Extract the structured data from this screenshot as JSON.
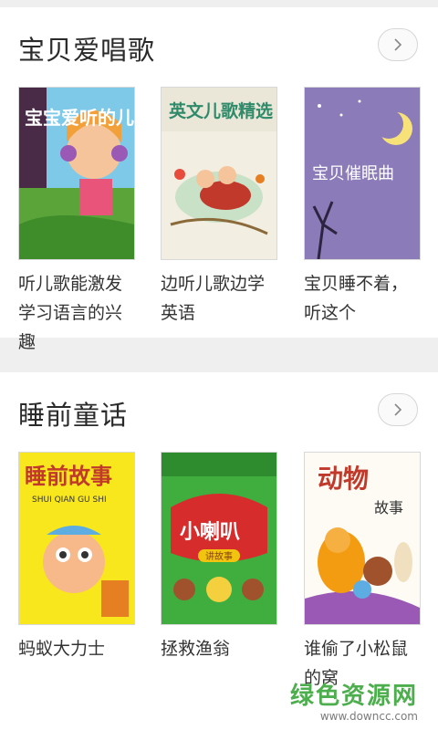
{
  "sections": [
    {
      "title": "宝贝爱唱歌",
      "items": [
        {
          "cover_text": "宝宝爱听的儿歌",
          "label": "听儿歌能激发学习语言的兴趣"
        },
        {
          "cover_text": "英文儿歌精选",
          "label": "边听儿歌边学英语"
        },
        {
          "cover_text": "宝贝催眠曲",
          "label": "宝贝睡不着，听这个"
        }
      ]
    },
    {
      "title": "睡前童话",
      "items": [
        {
          "cover_text": "睡前故事",
          "cover_subtext": "SHUI QIAN GU SHI",
          "label": "蚂蚁大力士"
        },
        {
          "cover_text": "小喇叭",
          "cover_subtext": "讲故事",
          "label": "拯救渔翁"
        },
        {
          "cover_text": "动物",
          "cover_subtext": "故事",
          "label": "谁偷了小松鼠的窝"
        }
      ]
    }
  ],
  "watermark": {
    "main": "绿色资源网",
    "sub": "www.downcc.com"
  },
  "colors": {
    "accent": "#4cae4c",
    "divider": "#efefef"
  }
}
